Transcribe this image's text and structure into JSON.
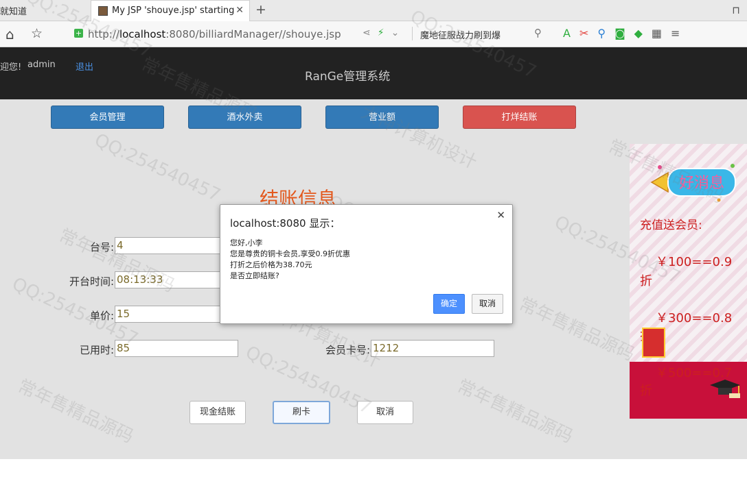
{
  "browser": {
    "prev_tab_title": "就知道",
    "active_tab_title": "My JSP 'shouye.jsp' starting page",
    "url_prefix": "http://",
    "url_host": "localhost",
    "url_rest": ":8080/billiardManager//shouye.jsp",
    "search_text": "魔地征服战力刷到爆"
  },
  "header": {
    "welcome": "迎您!",
    "username": "admin",
    "logout_label": "退出",
    "system_title": "RanGe管理系统"
  },
  "nav": {
    "member": "会员管理",
    "drinks": "酒水外卖",
    "revenue": "营业额",
    "checkout": "打烊结账"
  },
  "form": {
    "title": "结账信息",
    "table_no_label": "台号:",
    "table_no_value": "4",
    "start_time_label": "开台时间:",
    "start_time_value": "08:13:33",
    "unit_price_label": "单价:",
    "unit_price_value": "15",
    "used_time_label": "已用时:",
    "used_time_value": "85",
    "card_no_label": "会员卡号:",
    "card_no_value": "1212"
  },
  "actions": {
    "cash": "现金结账",
    "card": "刷卡",
    "cancel": "取消"
  },
  "promo": {
    "badge": "好消息",
    "title": "充值送会员:",
    "line1": "￥100==0.9",
    "line2": "￥300==0.8",
    "line3": "￥500==0.7",
    "zhe": "折"
  },
  "dialog": {
    "title": "localhost:8080 显示：",
    "line1": "您好,小李",
    "line2": "您是尊贵的铜卡会员,享受0.9折优惠",
    "line3": "打折之后价格为38.70元",
    "line4": "是否立即结账?",
    "ok": "确定",
    "cancel": "取消"
  },
  "watermark": {
    "qq": "QQ:254540457",
    "brand1": "常年售精品源码",
    "brand2": "大神计算机设计"
  },
  "colors": {
    "header_bg": "#222222",
    "nav_blue": "#337ab7",
    "nav_red": "#d9534f",
    "title_orange": "#e3591e",
    "promo_red": "#cc1f1f"
  }
}
